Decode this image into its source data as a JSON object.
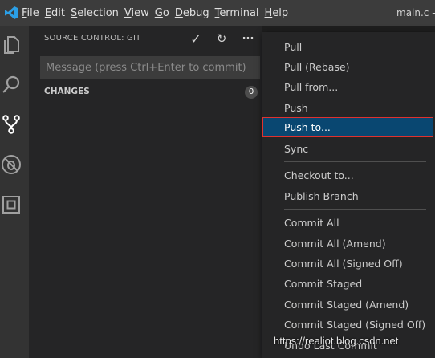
{
  "window": {
    "title": "main.c - "
  },
  "menubar": {
    "items": [
      {
        "mnemonic": "F",
        "rest": "ile"
      },
      {
        "mnemonic": "E",
        "rest": "dit"
      },
      {
        "mnemonic": "S",
        "rest": "election"
      },
      {
        "mnemonic": "V",
        "rest": "iew"
      },
      {
        "mnemonic": "G",
        "rest": "o"
      },
      {
        "mnemonic": "D",
        "rest": "ebug"
      },
      {
        "mnemonic": "T",
        "rest": "erminal"
      },
      {
        "mnemonic": "H",
        "rest": "elp"
      }
    ]
  },
  "activitybar": {
    "icons": [
      "explorer-icon",
      "search-icon",
      "source-control-icon",
      "debug-icon",
      "extensions-icon"
    ]
  },
  "source_control": {
    "title": "SOURCE CONTROL: GIT",
    "commit_icon": "✓",
    "refresh_icon": "↻",
    "more_icon": "···",
    "message_placeholder": "Message (press Ctrl+Enter to commit)",
    "changes_label": "CHANGES",
    "changes_count": "0"
  },
  "context_menu": {
    "items": [
      {
        "label": "Pull"
      },
      {
        "label": "Pull (Rebase)"
      },
      {
        "label": "Pull from..."
      },
      {
        "label": "Push"
      },
      {
        "label": "Push to...",
        "active": true
      },
      {
        "label": "Sync"
      },
      {
        "label": "Checkout to..."
      },
      {
        "label": "Publish Branch"
      },
      {
        "label": "Commit All"
      },
      {
        "label": "Commit All (Amend)"
      },
      {
        "label": "Commit All (Signed Off)"
      },
      {
        "label": "Commit Staged"
      },
      {
        "label": "Commit Staged (Amend)"
      },
      {
        "label": "Commit Staged (Signed Off)"
      },
      {
        "label": "Undo Last Commit"
      }
    ]
  },
  "watermark": "https://realiot.blog.csdn.net",
  "colors": {
    "accent": "#094771",
    "highlight_border": "#e0312f",
    "logo": "#2b9fe6"
  }
}
